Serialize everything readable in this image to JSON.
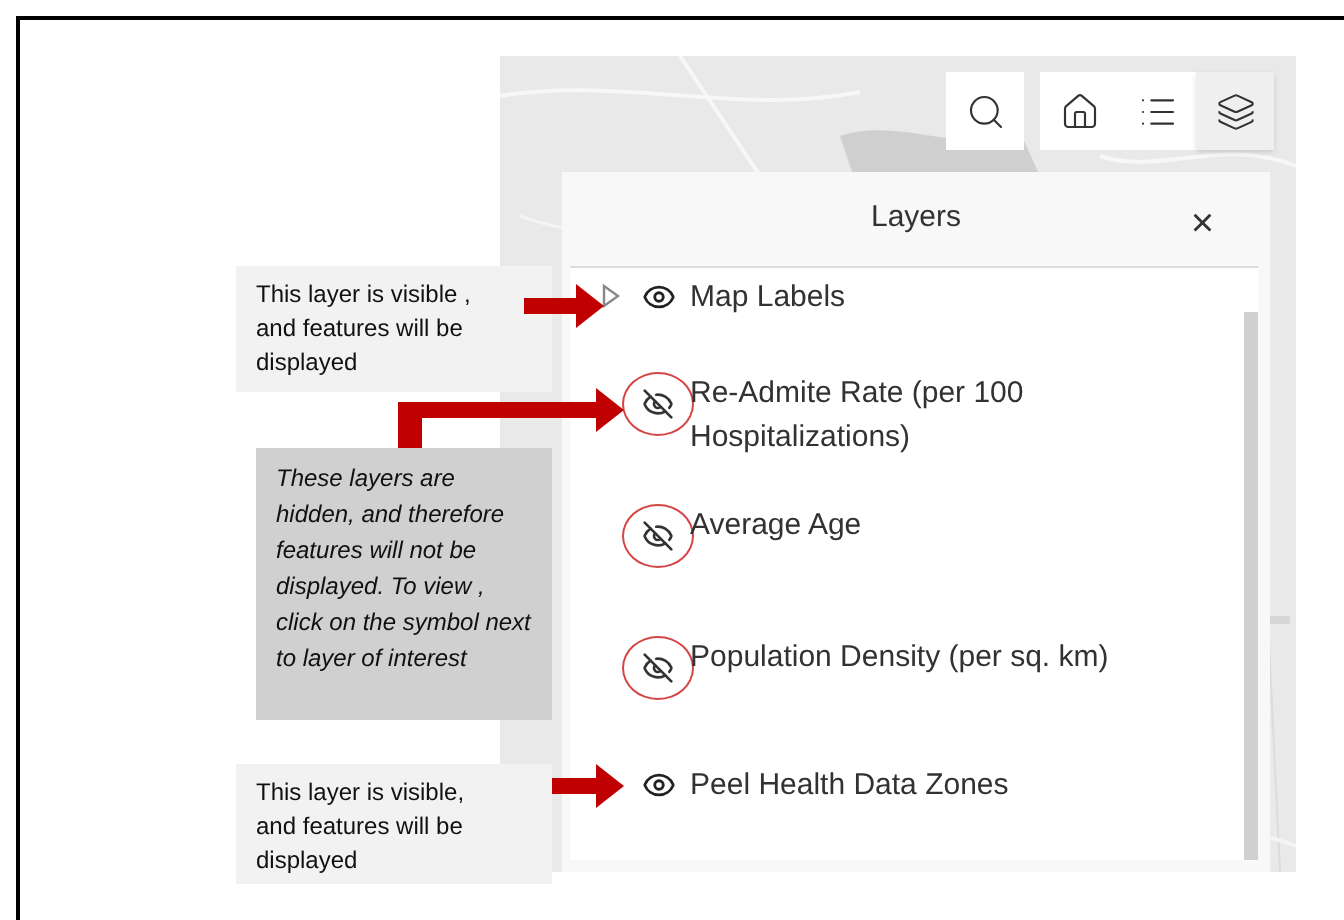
{
  "toolbar": [
    {
      "kind": "search",
      "selected": false
    },
    {
      "kind": "home",
      "selected": false
    },
    {
      "kind": "legend",
      "selected": false
    },
    {
      "kind": "layers",
      "selected": true
    }
  ],
  "panel": {
    "title": "Layers",
    "close": "×"
  },
  "layers": [
    {
      "name": "Map Labels",
      "visible": true,
      "expandable": true
    },
    {
      "name": "Re-Admite Rate (per 100 Hospitalizations)",
      "visible": false,
      "expandable": false
    },
    {
      "name": "Average Age",
      "visible": false,
      "expandable": false
    },
    {
      "name": "Population Density (per sq. km)",
      "visible": false,
      "expandable": false
    },
    {
      "name": "Peel Health Data Zones",
      "visible": true,
      "expandable": false
    }
  ],
  "callouts": [
    {
      "text": "This layer is visible , and features will be displayed",
      "kind": "visible"
    },
    {
      "text": "These layers are hidden, and therefore features will not be displayed. To view , click on the symbol next to layer of interest",
      "kind": "hidden"
    },
    {
      "text": "This layer is visible, and features will be displayed",
      "kind": "visible"
    }
  ]
}
